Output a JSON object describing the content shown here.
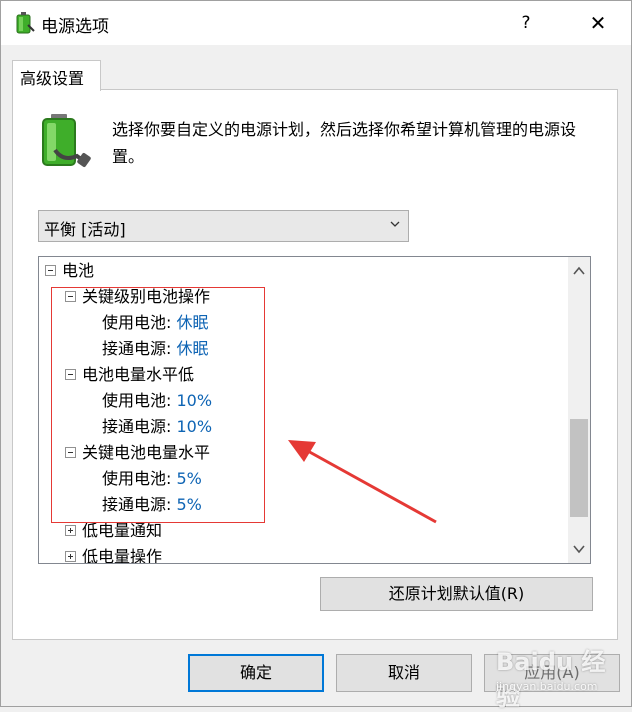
{
  "window": {
    "title": "电源选项",
    "help": "?",
    "close": "✕"
  },
  "tab": {
    "label": "高级设置"
  },
  "description": "选择你要自定义的电源计划，然后选择你希望计算机管理的电源设置。",
  "plan_select": {
    "value": "平衡 [活动]"
  },
  "tree": {
    "root": "电池",
    "on_battery_label": "使用电池:",
    "plugged_in_label": "接通电源:",
    "groups": [
      {
        "label": "关键级别电池操作",
        "on_battery": "休眠",
        "plugged_in": "休眠"
      },
      {
        "label": "电池电量水平低",
        "on_battery": "10%",
        "plugged_in": "10%"
      },
      {
        "label": "关键电池电量水平",
        "on_battery": "5%",
        "plugged_in": "5%"
      }
    ],
    "collapsed": [
      "低电量通知",
      "低电量操作"
    ]
  },
  "buttons": {
    "restore": "还原计划默认值(R)",
    "ok": "确定",
    "cancel": "取消",
    "apply": "应用(A)"
  },
  "watermark": {
    "brand": "Baidu 经验",
    "url": "jingyan.baidu.com"
  },
  "colors": {
    "value_link": "#0e64b4",
    "annotation": "#e53935",
    "default_button_border": "#0078d7"
  }
}
